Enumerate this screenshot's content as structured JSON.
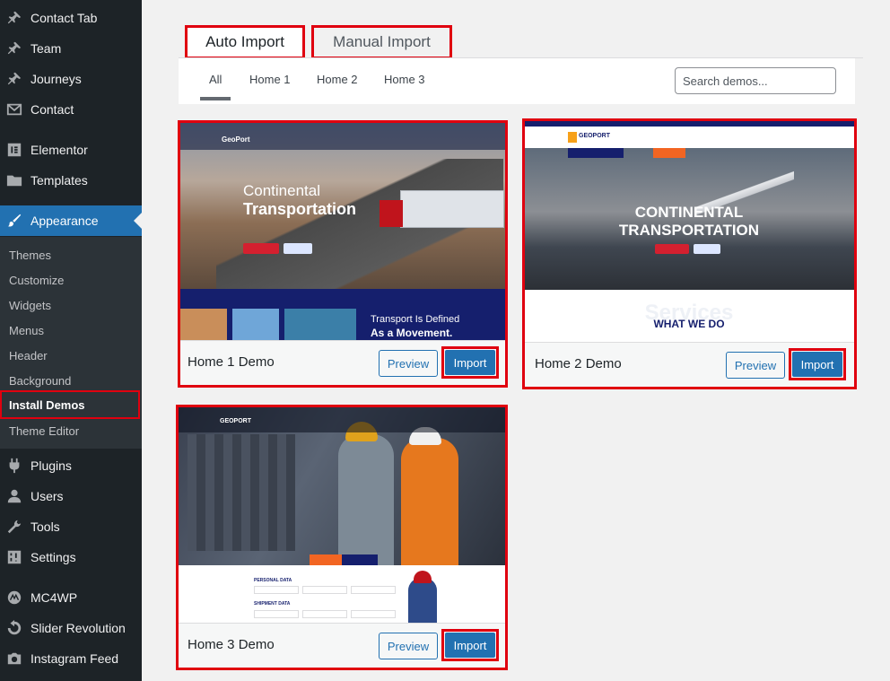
{
  "sidebar": {
    "items": [
      {
        "label": "Contact Tab",
        "icon": "pin-icon"
      },
      {
        "label": "Team",
        "icon": "pin-icon"
      },
      {
        "label": "Journeys",
        "icon": "pin-icon"
      },
      {
        "label": "Contact",
        "icon": "mail-icon"
      },
      {
        "label": "Elementor",
        "icon": "elementor-icon"
      },
      {
        "label": "Templates",
        "icon": "folder-icon"
      },
      {
        "label": "Appearance",
        "icon": "brush-icon"
      },
      {
        "label": "Plugins",
        "icon": "plugin-icon"
      },
      {
        "label": "Users",
        "icon": "user-icon"
      },
      {
        "label": "Tools",
        "icon": "wrench-icon"
      },
      {
        "label": "Settings",
        "icon": "settings-icon"
      },
      {
        "label": "MC4WP",
        "icon": "mc4wp-icon"
      },
      {
        "label": "Slider Revolution",
        "icon": "refresh-icon"
      },
      {
        "label": "Instagram Feed",
        "icon": "camera-icon"
      }
    ],
    "submenu": [
      "Themes",
      "Customize",
      "Widgets",
      "Menus",
      "Header",
      "Background",
      "Install Demos",
      "Theme Editor"
    ]
  },
  "tabs": {
    "auto": "Auto Import",
    "manual": "Manual Import"
  },
  "filters": [
    "All",
    "Home 1",
    "Home 2",
    "Home 3"
  ],
  "search": {
    "placeholder": "Search demos..."
  },
  "demos": [
    {
      "title": "Home 1 Demo",
      "preview": "Preview",
      "import": "Import",
      "hero_light": "Continental",
      "hero_bold": "Transportation",
      "section_light": "Transport Is Defined",
      "section_bold": "As a Movement.",
      "logo": "GeoPort"
    },
    {
      "title": "Home 2 Demo",
      "preview": "Preview",
      "import": "Import",
      "hero_line1": "CONTINENTAL",
      "hero_line2": "TRANSPORTATION",
      "services_bg": "Services",
      "what_we_do": "WHAT WE DO",
      "logo": "GEOPORT"
    },
    {
      "title": "Home 3 Demo",
      "preview": "Preview",
      "import": "Import",
      "personal": "PERSONAL DATA",
      "shipment": "SHIPMENT DATA",
      "logo": "GEOPORT"
    }
  ],
  "colors": {
    "accent": "#2271b1",
    "highlight": "#e0000f",
    "sidebar": "#1d2327"
  }
}
